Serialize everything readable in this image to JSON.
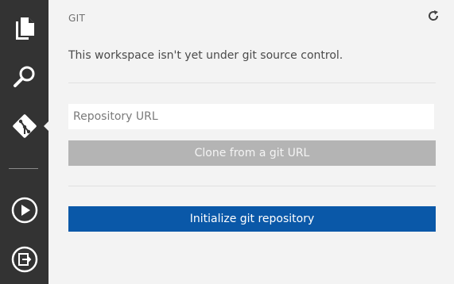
{
  "activity_bar": {
    "items": [
      {
        "name": "explorer",
        "icon": "files-icon"
      },
      {
        "name": "search",
        "icon": "search-icon"
      },
      {
        "name": "git",
        "icon": "git-icon",
        "active": true
      },
      {
        "name": "debug",
        "icon": "debug-play-icon"
      },
      {
        "name": "extensions",
        "icon": "extensions-icon"
      }
    ],
    "background": "#333333",
    "icon_color": "#ffffff"
  },
  "panel": {
    "title": "GIT",
    "refresh_icon": "refresh-icon",
    "message": "This workspace isn't yet under git source control.",
    "repo_input": {
      "value": "",
      "placeholder": "Repository URL"
    },
    "clone_button": {
      "label": "Clone from a git URL",
      "enabled": false,
      "color": "#b4b4b4"
    },
    "init_button": {
      "label": "Initialize git repository",
      "color": "#0a58a8"
    }
  }
}
